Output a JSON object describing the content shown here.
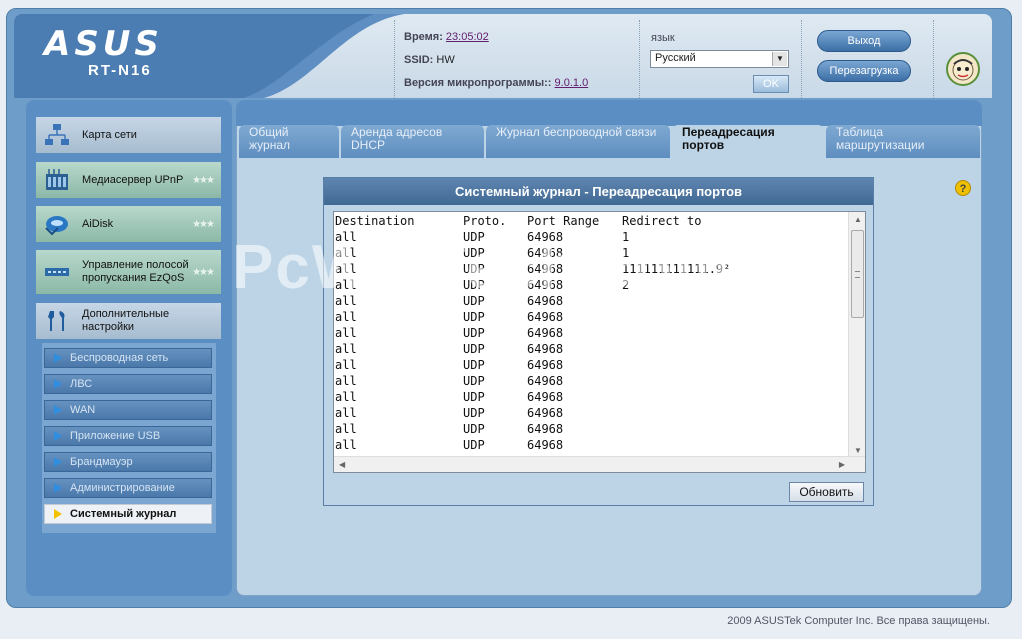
{
  "brand": {
    "logo": "ASUS",
    "model": "RT-N16"
  },
  "info": {
    "time_label": "Время:",
    "time_value": "23:05:02",
    "ssid_label": "SSID:",
    "ssid_value": "HW",
    "fw_label": "Версия микропрограммы::",
    "fw_value": "9.0.1.0"
  },
  "lang": {
    "label": "язык",
    "selected": "Русский",
    "ok_label": "OK"
  },
  "buttons": {
    "logout": "Выход",
    "reboot": "Перезагрузка",
    "refresh": "Обновить"
  },
  "sidebar": {
    "items": [
      {
        "label": "Карта сети",
        "icon": "network-map-icon"
      },
      {
        "label": "Медиасервер UPnP",
        "icon": "media-server-icon"
      },
      {
        "label": "AiDisk",
        "icon": "aidisk-icon"
      },
      {
        "label": "Управление полосой пропускания EzQoS",
        "icon": "qos-icon"
      },
      {
        "label": "Дополнительные настройки",
        "icon": "tools-icon"
      }
    ],
    "sub": [
      {
        "label": "Беспроводная сеть"
      },
      {
        "label": "ЛВС"
      },
      {
        "label": "WAN"
      },
      {
        "label": "Приложение USB"
      },
      {
        "label": "Брандмауэр"
      },
      {
        "label": "Администрирование"
      },
      {
        "label": "Системный журнал"
      }
    ]
  },
  "tabs": [
    {
      "label": "Общий журнал"
    },
    {
      "label": "Аренда адресов DHCP"
    },
    {
      "label": "Журнал беспроводной связи"
    },
    {
      "label": "Переадресация портов"
    },
    {
      "label": "Таблица маршрутизации"
    }
  ],
  "panel": {
    "title": "Системный журнал - Переадресация портов",
    "columns": [
      "Destination",
      "Proto.",
      "Port Range",
      "Redirect to"
    ],
    "rows": [
      [
        "all",
        "UDP",
        "64968",
        "1"
      ],
      [
        "all",
        "UDP",
        "64968",
        "1"
      ],
      [
        "all",
        "UDP",
        "64968",
        "111111111111.9²"
      ],
      [
        "all",
        "UDP",
        "64968",
        "2"
      ],
      [
        "all",
        "UDP",
        "64968",
        ""
      ],
      [
        "all",
        "UDP",
        "64968",
        ""
      ],
      [
        "all",
        "UDP",
        "64968",
        ""
      ],
      [
        "all",
        "UDP",
        "64968",
        ""
      ],
      [
        "all",
        "UDP",
        "64968",
        ""
      ],
      [
        "all",
        "UDP",
        "64968",
        ""
      ],
      [
        "all",
        "UDP",
        "64968",
        ""
      ],
      [
        "all",
        "UDP",
        "64968",
        ""
      ],
      [
        "all",
        "UDP",
        "64968",
        ""
      ],
      [
        "all",
        "UDP",
        "64968",
        ""
      ]
    ]
  },
  "watermark": "PcWinTech.com",
  "footer": "2009 ASUSTek Computer Inc. Все права защищены."
}
